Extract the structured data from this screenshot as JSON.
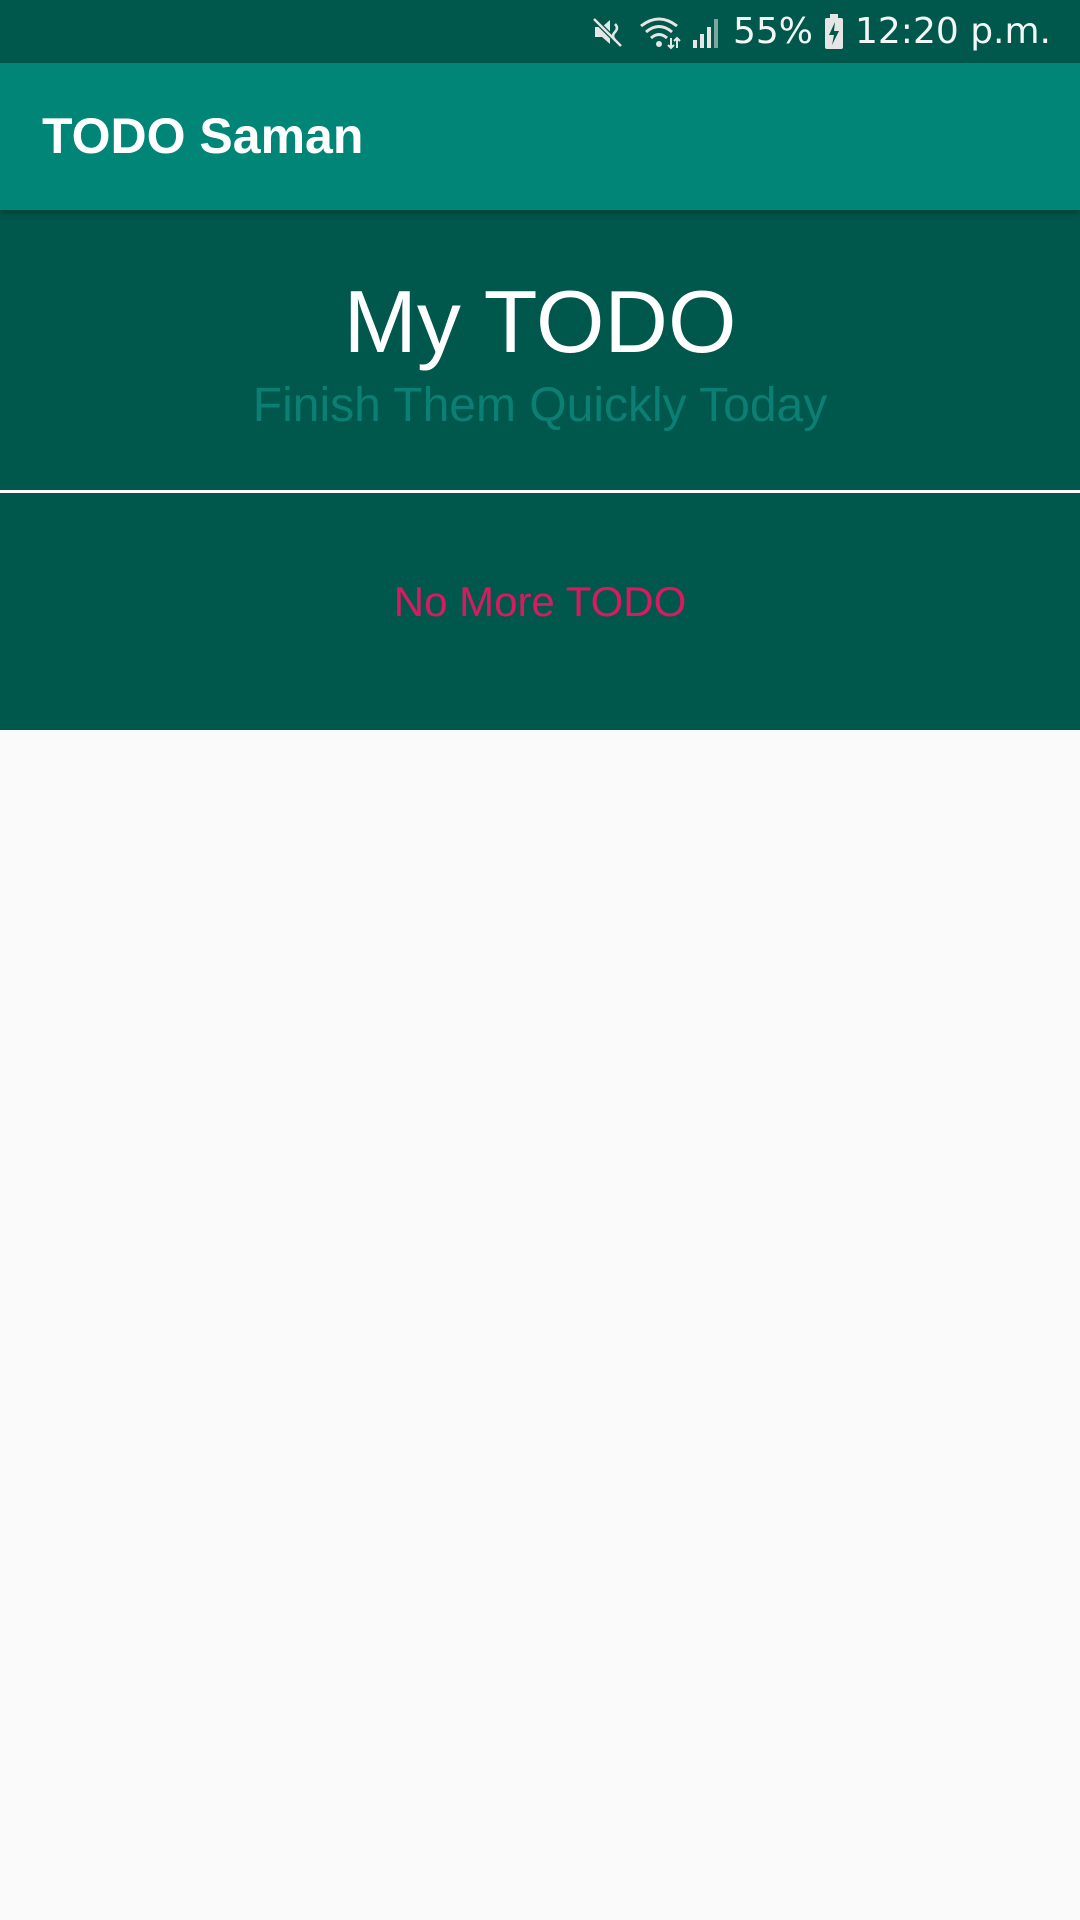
{
  "status_bar": {
    "battery_percent": "55%",
    "time": "12:20 p.m.",
    "icons": [
      "mute-icon",
      "wifi-icon",
      "signal-icon",
      "battery-charging-icon"
    ]
  },
  "app_bar": {
    "title": "TODO Saman"
  },
  "header": {
    "title": "My TODO",
    "subtitle": "Finish Them Quickly Today"
  },
  "empty_state": {
    "message": "No More TODO"
  },
  "colors": {
    "status_bar": "#00574b",
    "app_bar": "#008577",
    "header_bg": "#00574b",
    "subtitle": "#0b7f74",
    "empty_message": "#d81b60",
    "content_bg": "#fafafa"
  }
}
